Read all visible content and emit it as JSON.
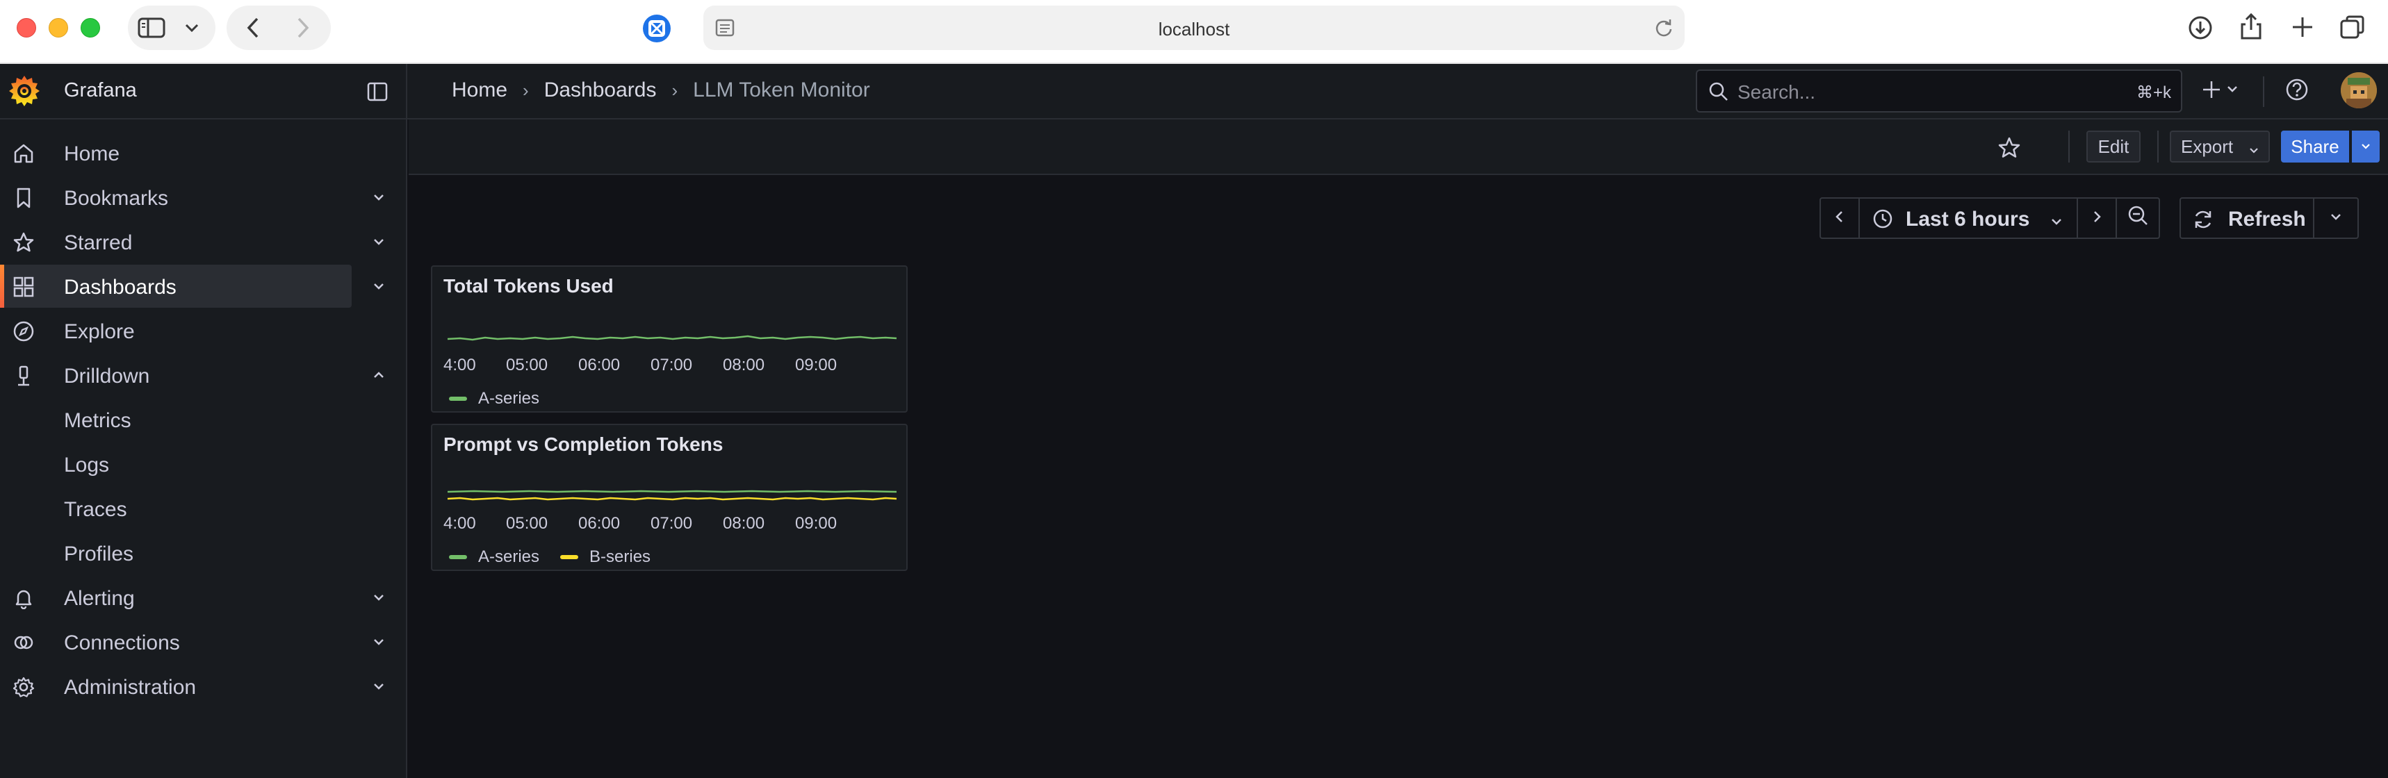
{
  "browser": {
    "url": "localhost"
  },
  "header": {
    "brand": "Grafana",
    "breadcrumb": [
      "Home",
      "Dashboards",
      "LLM Token Monitor"
    ],
    "search_placeholder": "Search...",
    "search_shortcut": "⌘+k"
  },
  "sidebar": {
    "items": [
      {
        "label": "Home",
        "icon": "home-icon"
      },
      {
        "label": "Bookmarks",
        "icon": "bookmark-icon",
        "expandable": true
      },
      {
        "label": "Starred",
        "icon": "star-icon",
        "expandable": true
      },
      {
        "label": "Dashboards",
        "icon": "dashboards-icon",
        "expandable": true,
        "active": true
      },
      {
        "label": "Explore",
        "icon": "compass-icon"
      },
      {
        "label": "Drilldown",
        "icon": "drilldown-icon",
        "expanded": true
      },
      {
        "label": "Metrics",
        "sub": true
      },
      {
        "label": "Logs",
        "sub": true
      },
      {
        "label": "Traces",
        "sub": true
      },
      {
        "label": "Profiles",
        "sub": true
      },
      {
        "label": "Alerting",
        "icon": "bell-icon",
        "expandable": true
      },
      {
        "label": "Connections",
        "icon": "connections-icon",
        "expandable": true
      },
      {
        "label": "Administration",
        "icon": "gear-icon",
        "expandable": true
      }
    ]
  },
  "toolbar": {
    "edit_label": "Edit",
    "export_label": "Export",
    "share_label": "Share"
  },
  "time_picker": {
    "range_label": "Last 6 hours",
    "refresh_label": "Refresh"
  },
  "panels": [
    {
      "title": "Total Tokens Used",
      "x_ticks": [
        "4:00",
        "05:00",
        "06:00",
        "07:00",
        "08:00",
        "09:00"
      ],
      "legend": [
        {
          "name": "A-series",
          "color": "#73bf69"
        }
      ]
    },
    {
      "title": "Prompt vs Completion Tokens",
      "x_ticks": [
        "4:00",
        "05:00",
        "06:00",
        "07:00",
        "08:00",
        "09:00"
      ],
      "legend": [
        {
          "name": "A-series",
          "color": "#73bf69"
        },
        {
          "name": "B-series",
          "color": "#fade2a"
        }
      ]
    }
  ]
}
